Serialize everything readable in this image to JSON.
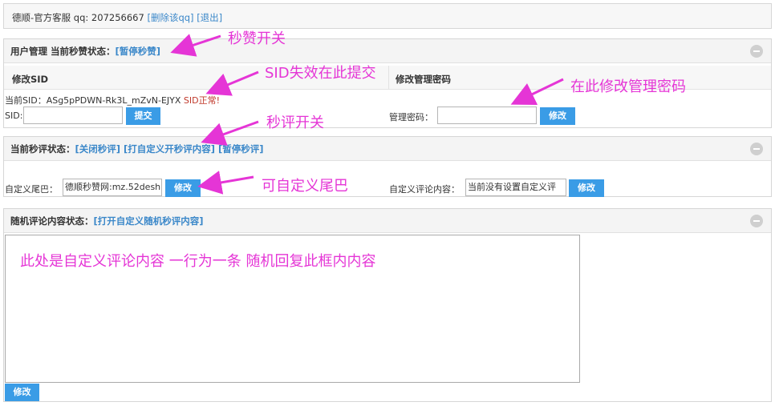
{
  "topbar": {
    "service": "德顺-官方客服 qq: 207256667",
    "delete_qq": "[删除该qq]",
    "logout": "[退出]"
  },
  "panel1": {
    "title": "用户管理 当前秒赞状态：",
    "status_link": "[暂停秒赞]",
    "sid": {
      "header": "修改SID",
      "current_label": "当前SID：ASg5pPDWN-Rk3L_mZvN-EJYX",
      "sid_status": "SID正常!",
      "input_label": "SID:",
      "input_value": "",
      "submit": "提交"
    },
    "password": {
      "header": "修改管理密码",
      "label": "管理密码：",
      "value": "",
      "button": "修改"
    }
  },
  "panel2": {
    "title": "当前秒评状态：",
    "links": [
      "[关闭秒评]",
      "[打自定义开秒评内容]",
      "[暂停秒评]"
    ],
    "tail_label": "自定义尾巴：",
    "tail_value": "德顺秒赞网:mz.52desh",
    "tail_button": "修改",
    "comment_label": "自定义评论内容：",
    "comment_value": "当前没有设置自定义评",
    "comment_button": "修改"
  },
  "panel3": {
    "title": "随机评论内容状态：",
    "link": "[打开自定义随机秒评内容]",
    "textarea_text": "此处是自定义评论内容 一行为一条 随机回复此框内内容",
    "button": "修改"
  },
  "annotations": {
    "a1": "秒赞开关",
    "a2": "SID失效在此提交",
    "a3": "在此修改管理密码",
    "a4": "秒评开关",
    "a5": "可自定义尾巴"
  },
  "colors": {
    "accent": "#3a9ce6",
    "link": "#3a87c9",
    "annotation": "#e535d6",
    "sid_ok": "#c0392b"
  }
}
